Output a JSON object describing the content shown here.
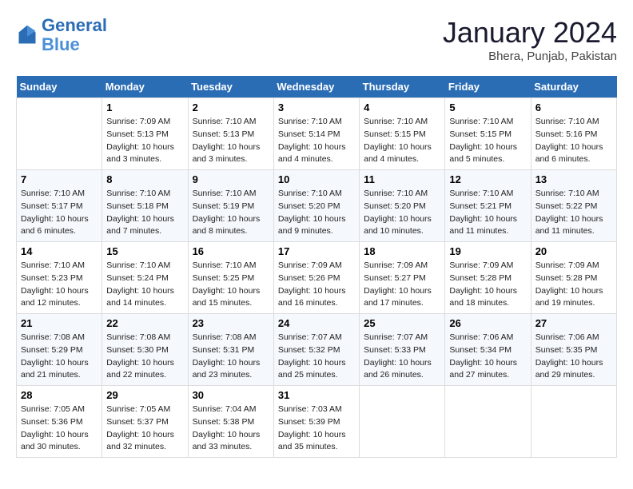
{
  "header": {
    "logo_line1": "General",
    "logo_line2": "Blue",
    "main_title": "January 2024",
    "subtitle": "Bhera, Punjab, Pakistan"
  },
  "days_of_week": [
    "Sunday",
    "Monday",
    "Tuesday",
    "Wednesday",
    "Thursday",
    "Friday",
    "Saturday"
  ],
  "weeks": [
    [
      {
        "day": "",
        "info": ""
      },
      {
        "day": "1",
        "info": "Sunrise: 7:09 AM\nSunset: 5:13 PM\nDaylight: 10 hours\nand 3 minutes."
      },
      {
        "day": "2",
        "info": "Sunrise: 7:10 AM\nSunset: 5:13 PM\nDaylight: 10 hours\nand 3 minutes."
      },
      {
        "day": "3",
        "info": "Sunrise: 7:10 AM\nSunset: 5:14 PM\nDaylight: 10 hours\nand 4 minutes."
      },
      {
        "day": "4",
        "info": "Sunrise: 7:10 AM\nSunset: 5:15 PM\nDaylight: 10 hours\nand 4 minutes."
      },
      {
        "day": "5",
        "info": "Sunrise: 7:10 AM\nSunset: 5:15 PM\nDaylight: 10 hours\nand 5 minutes."
      },
      {
        "day": "6",
        "info": "Sunrise: 7:10 AM\nSunset: 5:16 PM\nDaylight: 10 hours\nand 6 minutes."
      }
    ],
    [
      {
        "day": "7",
        "info": "Sunrise: 7:10 AM\nSunset: 5:17 PM\nDaylight: 10 hours\nand 6 minutes."
      },
      {
        "day": "8",
        "info": "Sunrise: 7:10 AM\nSunset: 5:18 PM\nDaylight: 10 hours\nand 7 minutes."
      },
      {
        "day": "9",
        "info": "Sunrise: 7:10 AM\nSunset: 5:19 PM\nDaylight: 10 hours\nand 8 minutes."
      },
      {
        "day": "10",
        "info": "Sunrise: 7:10 AM\nSunset: 5:20 PM\nDaylight: 10 hours\nand 9 minutes."
      },
      {
        "day": "11",
        "info": "Sunrise: 7:10 AM\nSunset: 5:20 PM\nDaylight: 10 hours\nand 10 minutes."
      },
      {
        "day": "12",
        "info": "Sunrise: 7:10 AM\nSunset: 5:21 PM\nDaylight: 10 hours\nand 11 minutes."
      },
      {
        "day": "13",
        "info": "Sunrise: 7:10 AM\nSunset: 5:22 PM\nDaylight: 10 hours\nand 11 minutes."
      }
    ],
    [
      {
        "day": "14",
        "info": "Sunrise: 7:10 AM\nSunset: 5:23 PM\nDaylight: 10 hours\nand 12 minutes."
      },
      {
        "day": "15",
        "info": "Sunrise: 7:10 AM\nSunset: 5:24 PM\nDaylight: 10 hours\nand 14 minutes."
      },
      {
        "day": "16",
        "info": "Sunrise: 7:10 AM\nSunset: 5:25 PM\nDaylight: 10 hours\nand 15 minutes."
      },
      {
        "day": "17",
        "info": "Sunrise: 7:09 AM\nSunset: 5:26 PM\nDaylight: 10 hours\nand 16 minutes."
      },
      {
        "day": "18",
        "info": "Sunrise: 7:09 AM\nSunset: 5:27 PM\nDaylight: 10 hours\nand 17 minutes."
      },
      {
        "day": "19",
        "info": "Sunrise: 7:09 AM\nSunset: 5:28 PM\nDaylight: 10 hours\nand 18 minutes."
      },
      {
        "day": "20",
        "info": "Sunrise: 7:09 AM\nSunset: 5:28 PM\nDaylight: 10 hours\nand 19 minutes."
      }
    ],
    [
      {
        "day": "21",
        "info": "Sunrise: 7:08 AM\nSunset: 5:29 PM\nDaylight: 10 hours\nand 21 minutes."
      },
      {
        "day": "22",
        "info": "Sunrise: 7:08 AM\nSunset: 5:30 PM\nDaylight: 10 hours\nand 22 minutes."
      },
      {
        "day": "23",
        "info": "Sunrise: 7:08 AM\nSunset: 5:31 PM\nDaylight: 10 hours\nand 23 minutes."
      },
      {
        "day": "24",
        "info": "Sunrise: 7:07 AM\nSunset: 5:32 PM\nDaylight: 10 hours\nand 25 minutes."
      },
      {
        "day": "25",
        "info": "Sunrise: 7:07 AM\nSunset: 5:33 PM\nDaylight: 10 hours\nand 26 minutes."
      },
      {
        "day": "26",
        "info": "Sunrise: 7:06 AM\nSunset: 5:34 PM\nDaylight: 10 hours\nand 27 minutes."
      },
      {
        "day": "27",
        "info": "Sunrise: 7:06 AM\nSunset: 5:35 PM\nDaylight: 10 hours\nand 29 minutes."
      }
    ],
    [
      {
        "day": "28",
        "info": "Sunrise: 7:05 AM\nSunset: 5:36 PM\nDaylight: 10 hours\nand 30 minutes."
      },
      {
        "day": "29",
        "info": "Sunrise: 7:05 AM\nSunset: 5:37 PM\nDaylight: 10 hours\nand 32 minutes."
      },
      {
        "day": "30",
        "info": "Sunrise: 7:04 AM\nSunset: 5:38 PM\nDaylight: 10 hours\nand 33 minutes."
      },
      {
        "day": "31",
        "info": "Sunrise: 7:03 AM\nSunset: 5:39 PM\nDaylight: 10 hours\nand 35 minutes."
      },
      {
        "day": "",
        "info": ""
      },
      {
        "day": "",
        "info": ""
      },
      {
        "day": "",
        "info": ""
      }
    ]
  ]
}
